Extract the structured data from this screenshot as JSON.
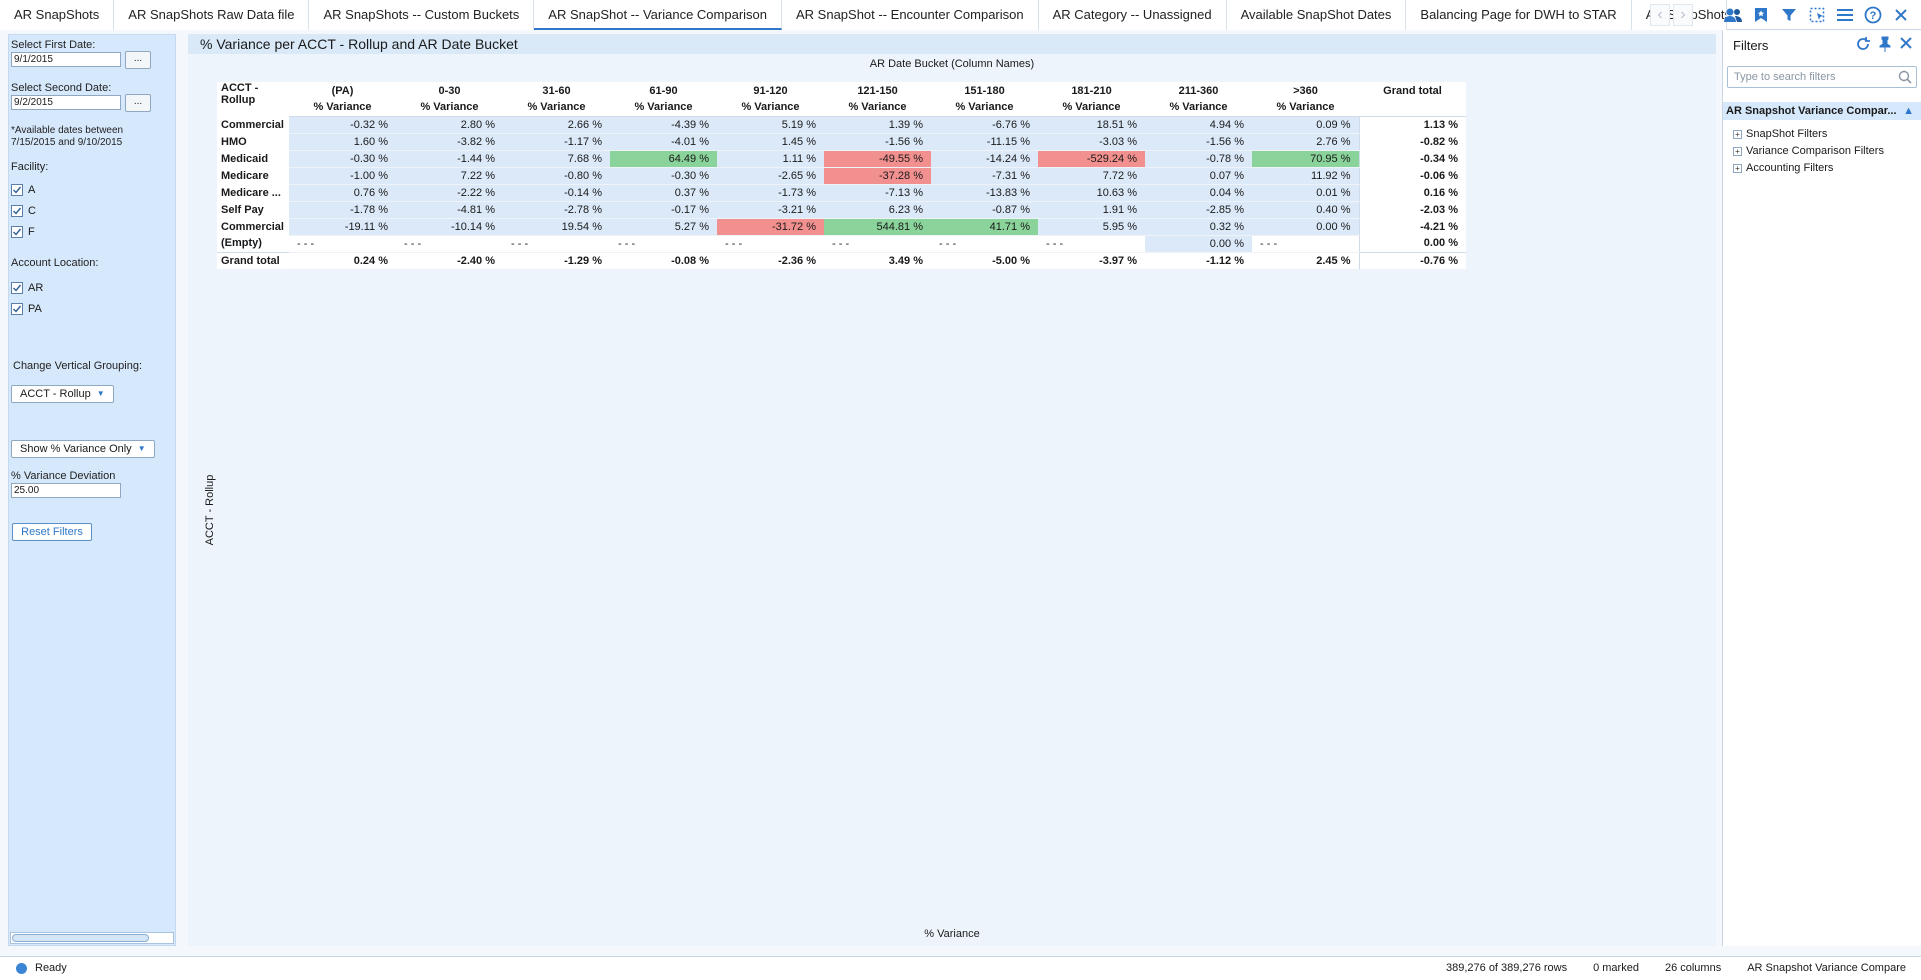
{
  "tabs": [
    {
      "label": "AR SnapShots",
      "active": false
    },
    {
      "label": "AR SnapShots Raw Data file",
      "active": false
    },
    {
      "label": "AR SnapShots -- Custom Buckets",
      "active": false
    },
    {
      "label": "AR SnapShot -- Variance Comparison",
      "active": true
    },
    {
      "label": "AR SnapShot -- Encounter Comparison",
      "active": false
    },
    {
      "label": "AR Category -- Unassigned",
      "active": false
    },
    {
      "label": "Available SnapShot Dates",
      "active": false
    },
    {
      "label": "Balancing Page for DWH to STAR",
      "active": false
    },
    {
      "label": "AR SnapShots",
      "active": false
    }
  ],
  "toolbar_icons": [
    "collaboration-icon",
    "bookmark-icon",
    "filter-icon",
    "selection-icon",
    "menu-icon",
    "help-icon",
    "close-icon"
  ],
  "left_panel": {
    "first_date_label": "Select First Date:",
    "first_date_value": "9/1/2015",
    "second_date_label": "Select Second Date:",
    "second_date_value": "9/2/2015",
    "browse_label": "...",
    "available_note_line1": "*Available dates between",
    "available_note_line2": "7/15/2015 and 9/10/2015",
    "facility_label": "Facility:",
    "facilities": [
      "A",
      "C",
      "F"
    ],
    "account_location_label": "Account Location:",
    "account_locations": [
      "AR",
      "PA"
    ],
    "vertical_grouping_label": "Change Vertical Grouping:",
    "vertical_grouping_value": "ACCT - Rollup",
    "show_variance_value": "Show % Variance Only",
    "variance_deviation_label": "% Variance Deviation",
    "variance_deviation_value": "25.00",
    "reset_button": "Reset Filters"
  },
  "visualization": {
    "title": "% Variance per ACCT - Rollup and AR Date Bucket",
    "column_axis_title": "AR Date Bucket  (Column Names)",
    "row_axis_title": "ACCT - Rollup",
    "value_axis_title": "% Variance",
    "corner_label_line1": "ACCT -",
    "corner_label_line2": "Rollup",
    "measure_label": "% Variance",
    "grand_total_label": "Grand total",
    "columns": [
      "(PA)",
      "0-30",
      "31-60",
      "61-90",
      "91-120",
      "121-150",
      "151-180",
      "181-210",
      "211-360",
      ">360"
    ],
    "rows": [
      {
        "name": "Commercial",
        "values": [
          "-0.32 %",
          "2.80 %",
          "2.66 %",
          "-4.39 %",
          "5.19 %",
          "1.39 %",
          "-6.76 %",
          "18.51 %",
          "4.94 %",
          "0.09 %"
        ],
        "total": "1.13 %",
        "flags": [
          "",
          "",
          "",
          "",
          "",
          "",
          "",
          "",
          "",
          ""
        ]
      },
      {
        "name": "HMO",
        "values": [
          "1.60 %",
          "-3.82 %",
          "-1.17 %",
          "-4.01 %",
          "1.45 %",
          "-1.56 %",
          "-11.15 %",
          "-3.03 %",
          "-1.56 %",
          "2.76 %"
        ],
        "total": "-0.82 %",
        "flags": [
          "",
          "",
          "",
          "",
          "",
          "",
          "",
          "",
          "",
          ""
        ]
      },
      {
        "name": "Medicaid",
        "values": [
          "-0.30 %",
          "-1.44 %",
          "7.68 %",
          "64.49 %",
          "1.11 %",
          "-49.55 %",
          "-14.24 %",
          "-529.24 %",
          "-0.78 %",
          "70.95 %"
        ],
        "total": "-0.34 %",
        "flags": [
          "",
          "",
          "",
          "green",
          "",
          "red",
          "",
          "red",
          "",
          "green"
        ]
      },
      {
        "name": "Medicare",
        "values": [
          "-1.00 %",
          "7.22 %",
          "-0.80 %",
          "-0.30 %",
          "-2.65 %",
          "-37.28 %",
          "-7.31 %",
          "7.72 %",
          "0.07 %",
          "11.92 %"
        ],
        "total": "-0.06 %",
        "flags": [
          "",
          "",
          "",
          "",
          "",
          "red",
          "",
          "",
          "",
          ""
        ]
      },
      {
        "name": "Medicare ...",
        "values": [
          "0.76 %",
          "-2.22 %",
          "-0.14 %",
          "0.37 %",
          "-1.73 %",
          "-7.13 %",
          "-13.83 %",
          "10.63 %",
          "0.04 %",
          "0.01 %"
        ],
        "total": "0.16 %",
        "flags": [
          "",
          "",
          "",
          "",
          "",
          "",
          "",
          "",
          "",
          ""
        ]
      },
      {
        "name": "Self Pay",
        "values": [
          "-1.78 %",
          "-4.81 %",
          "-2.78 %",
          "-0.17 %",
          "-3.21 %",
          "6.23 %",
          "-0.87 %",
          "1.91 %",
          "-2.85 %",
          "0.40 %"
        ],
        "total": "-2.03 %",
        "flags": [
          "",
          "",
          "",
          "",
          "",
          "",
          "",
          "",
          "",
          ""
        ]
      },
      {
        "name": "Commercial",
        "values": [
          "-19.11 %",
          "-10.14 %",
          "19.54 %",
          "5.27 %",
          "-31.72 %",
          "544.81 %",
          "41.71 %",
          "5.95 %",
          "0.32 %",
          "0.00 %"
        ],
        "total": "-4.21 %",
        "flags": [
          "",
          "",
          "",
          "",
          "red",
          "green",
          "green",
          "",
          "",
          ""
        ]
      },
      {
        "name": "(Empty)",
        "values": [
          "- - -",
          "- - -",
          "- - -",
          "- - -",
          "- - -",
          "- - -",
          "- - -",
          "- - -",
          "0.00 %",
          "- - -"
        ],
        "total": "0.00 %",
        "flags": [
          "empty",
          "empty",
          "empty",
          "empty",
          "empty",
          "empty",
          "empty",
          "empty",
          "",
          "empty"
        ]
      }
    ],
    "grand_total_row": {
      "name": "Grand total",
      "values": [
        "0.24 %",
        "-2.40 %",
        "-1.29 %",
        "-0.08 %",
        "-2.36 %",
        "3.49 %",
        "-5.00 %",
        "-3.97 %",
        "-1.12 %",
        "2.45 %"
      ],
      "total": "-0.76 %"
    }
  },
  "filters_panel": {
    "title": "Filters",
    "search_placeholder": "Type to search filters",
    "group_title": "AR Snapshot Variance Compar...",
    "items": [
      "SnapShot Filters",
      "Variance Comparison Filters",
      "Accounting Filters"
    ]
  },
  "status_bar": {
    "ready": "Ready",
    "rows": "389,276 of 389,276 rows",
    "marked": "0 marked",
    "columns": "26 columns",
    "page": "AR Snapshot Variance Compare"
  },
  "colors": {
    "accent": "#2f77c8",
    "cell_blue": "#dbe9f9",
    "flag_red": "#f2908f",
    "flag_green": "#8ad39a"
  }
}
